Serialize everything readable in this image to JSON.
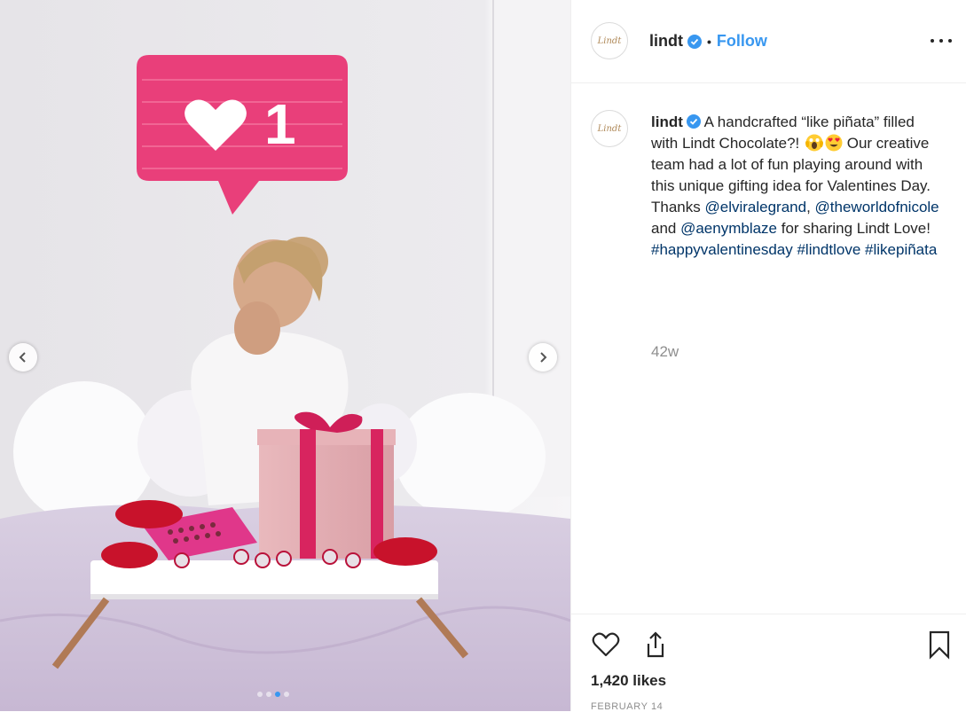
{
  "post": {
    "account": {
      "username": "lindt",
      "avatar_text": "Lindt",
      "verified": true,
      "follow_label": "Follow",
      "separator": "•"
    },
    "caption": {
      "username": "lindt",
      "text_1": " A handcrafted “like piñata” filled with Lindt Chocolate?! ",
      "emojis": [
        "face-screaming-emoji",
        "heart-eyes-emoji"
      ],
      "text_2": " Our creative team had a lot of fun playing around with this unique gifting idea for Valentines Day. Thanks ",
      "mention_1": "@elviralegrand",
      "text_3": ", ",
      "mention_2": "@theworldofnicole",
      "text_4": " and ",
      "mention_3": "@aenymblaze",
      "text_5": " for sharing Lindt Love! ",
      "hashtag_1": "#happyvalentinesday",
      "text_6": " ",
      "hashtag_2": "#lindtlove",
      "text_7": " ",
      "hashtag_3": "#likepiñata"
    },
    "age": "42w",
    "likes": "1,420 likes",
    "date": "FEBRUARY 14",
    "carousel": {
      "total": 4,
      "current": 3
    },
    "photo": {
      "pinata_count": "1",
      "description_icons": [
        "like-notification-pinata",
        "gift-box",
        "chocolate-box",
        "breakfast-tray"
      ]
    },
    "icons": {
      "like": "heart-icon",
      "share": "share-icon",
      "save": "bookmark-icon",
      "more": "more-options-icon",
      "prev": "chevron-left-icon",
      "next": "chevron-right-icon"
    },
    "colors": {
      "link": "#003569",
      "follow": "#3897f0",
      "verified": "#3897f0",
      "muted": "#8e8e8e",
      "pinata": "#e93f7a"
    }
  }
}
